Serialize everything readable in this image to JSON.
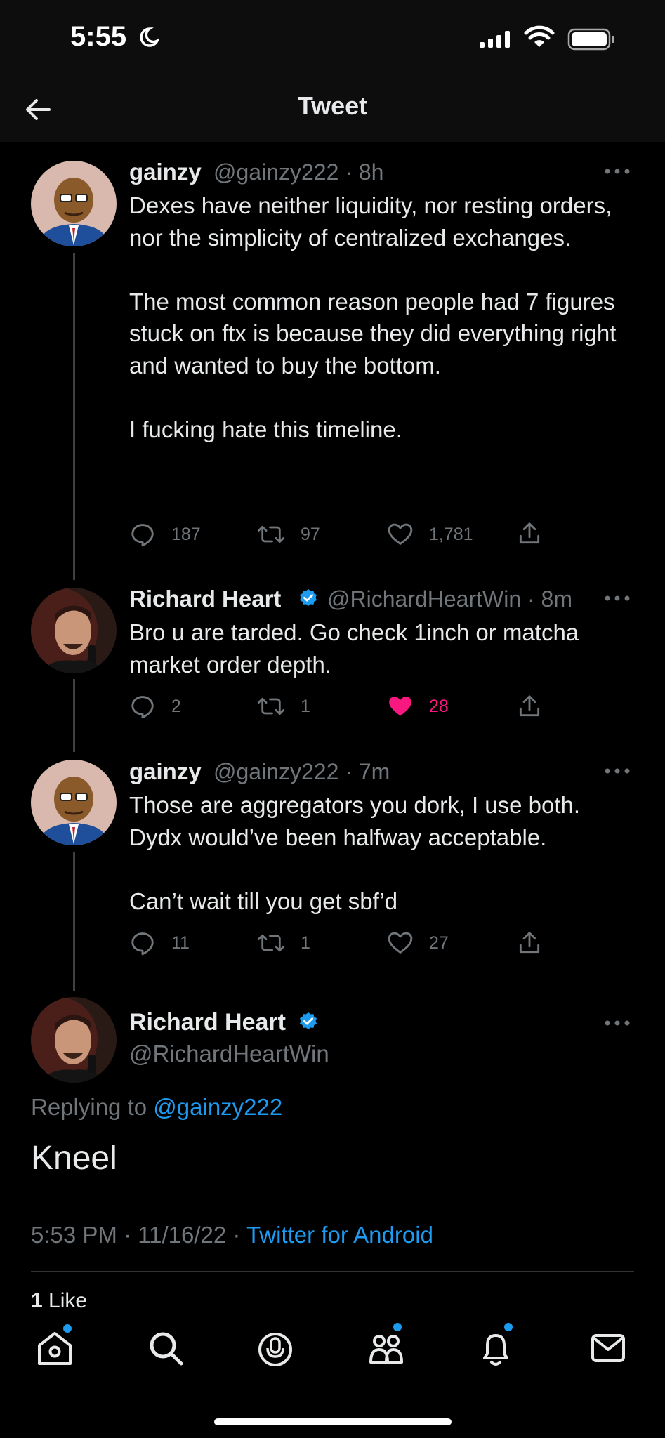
{
  "status_bar": {
    "time": "5:55"
  },
  "header": {
    "title": "Tweet"
  },
  "thread": [
    {
      "name": "gainzy",
      "verified": false,
      "handle": "@gainzy222",
      "time": "8h",
      "paragraphs": [
        "Dexes have neither liquidity, nor resting orders, nor the simplicity of centralized exchanges.",
        "The most common reason people had 7 figures stuck on ftx is because they did everything right and wanted to buy the bottom.",
        "I fucking hate this timeline."
      ],
      "replies": "187",
      "retweets": "97",
      "likes": "1,781",
      "liked": false
    },
    {
      "name": "Richard Heart",
      "verified": true,
      "handle": "@RichardHeartWin",
      "time": "8m",
      "paragraphs": [
        "Bro u are tarded. Go check 1inch or matcha market order depth."
      ],
      "replies": "2",
      "retweets": "1",
      "likes": "28",
      "liked": true
    },
    {
      "name": "gainzy",
      "verified": false,
      "handle": "@gainzy222",
      "time": "7m",
      "paragraphs": [
        "Those are aggregators you dork, I use both. Dydx would’ve been halfway acceptable.",
        "Can’t wait till you get sbf’d"
      ],
      "replies": "11",
      "retweets": "1",
      "likes": "27",
      "liked": false
    }
  ],
  "main_tweet": {
    "name": "Richard Heart",
    "handle": "@RichardHeartWin",
    "replying_prefix": "Replying to",
    "replying_to": "@gainzy222",
    "text": "Kneel",
    "timestamp": "5:53 PM · 11/16/22 ·",
    "source": "Twitter for Android",
    "likes_number": "1",
    "likes_label": "Like"
  },
  "colors": {
    "accent": "#1d9bf0",
    "like": "#f91880",
    "muted": "#71767b"
  },
  "tabs": [
    "home-icon",
    "search-icon",
    "spaces-icon",
    "communities-icon",
    "notifications-icon",
    "messages-icon"
  ]
}
